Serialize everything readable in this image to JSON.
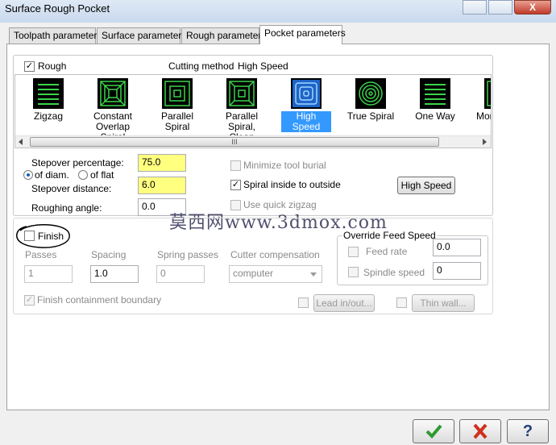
{
  "window": {
    "title": "Surface Rough Pocket",
    "close_glyph": "X"
  },
  "tabs": [
    "Toolpath parameters",
    "Surface parameters",
    "Rough parameters",
    "Pocket parameters"
  ],
  "rough": {
    "checkbox_label": "Rough",
    "checked": true,
    "cutting_method_label": "Cutting method",
    "cutting_method_value": "High Speed",
    "methods": [
      {
        "line1": "Zigzag",
        "line2": "",
        "icon": "zigzag-icon"
      },
      {
        "line1": "Constant",
        "line2": "Overlap Spiral",
        "icon": "constant-overlap-spiral-icon"
      },
      {
        "line1": "Parallel Spiral",
        "line2": "",
        "icon": "parallel-spiral-icon"
      },
      {
        "line1": "Parallel Spiral,",
        "line2": "Clean Corners",
        "icon": "parallel-spiral-clean-corners-icon"
      },
      {
        "line1": "High Speed",
        "line2": "",
        "icon": "high-speed-icon"
      },
      {
        "line1": "True Spiral",
        "line2": "",
        "icon": "true-spiral-icon"
      },
      {
        "line1": "One Way",
        "line2": "",
        "icon": "one-way-icon"
      },
      {
        "line1": "Mor",
        "line2": "",
        "icon": "morph-icon"
      }
    ],
    "scroll_thumb_glyph": "III",
    "stepover_percentage_label": "Stepover percentage:",
    "stepover_percentage_value": "75.0",
    "of_diam_label": "of diam.",
    "of_flat_label": "of flat",
    "stepover_distance_label": "Stepover distance:",
    "stepover_distance_value": "6.0",
    "roughing_angle_label": "Roughing angle:",
    "roughing_angle_value": "0.0",
    "minimize_tool_burial_label": "Minimize tool burial",
    "spiral_inside_label": "Spiral inside to outside",
    "use_quick_zigzag_label": "Use quick zigzag",
    "high_speed_button": "High Speed"
  },
  "watermark": "莫西网www.3dmox.com",
  "finish": {
    "checkbox_label": "Finish",
    "passes_label": "Passes",
    "passes_value": "1",
    "spacing_label": "Spacing",
    "spacing_value": "1.0",
    "spring_passes_label": "Spring passes",
    "spring_passes_value": "0",
    "cutter_comp_label": "Cutter compensation",
    "cutter_comp_value": "computer",
    "finish_containment_label": "Finish containment boundary",
    "lead_button": "Lead in/out...",
    "thin_wall_button": "Thin wall..."
  },
  "override": {
    "title": "Override Feed Speed",
    "feed_rate_label": "Feed rate",
    "feed_rate_value": "0.0",
    "spindle_speed_label": "Spindle speed",
    "spindle_speed_value": "0"
  },
  "dialog_buttons": {
    "ok_icon": "checkmark-icon",
    "cancel_icon": "x-icon",
    "help_icon": "question-icon",
    "help_glyph": "?"
  }
}
